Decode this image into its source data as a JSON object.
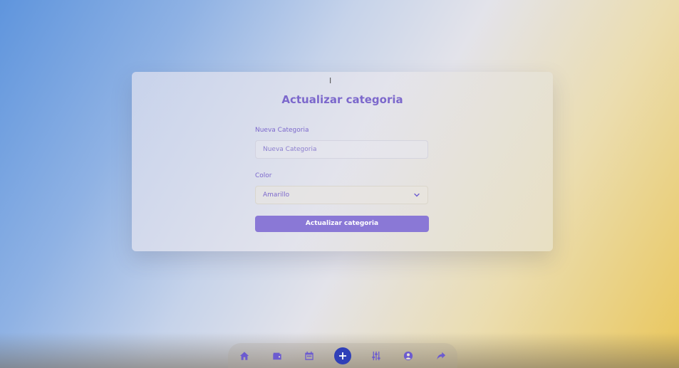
{
  "form": {
    "title": "Actualizar categoria",
    "category_label": "Nueva Categoria",
    "category_placeholder": "Nueva Categoria",
    "category_value": "",
    "color_label": "Color",
    "color_selected": "Amarillo",
    "submit_label": "Actualizar categoria"
  },
  "dock": {
    "items": [
      "home-icon",
      "wallet-icon",
      "calendar-icon",
      "add-icon",
      "sliders-icon",
      "user-icon",
      "share-icon"
    ],
    "accent": "#6c5bd0",
    "add_button_color": "#2f3fb8"
  },
  "colors": {
    "primary": "#7c68cc",
    "button": "#8a78d6"
  }
}
